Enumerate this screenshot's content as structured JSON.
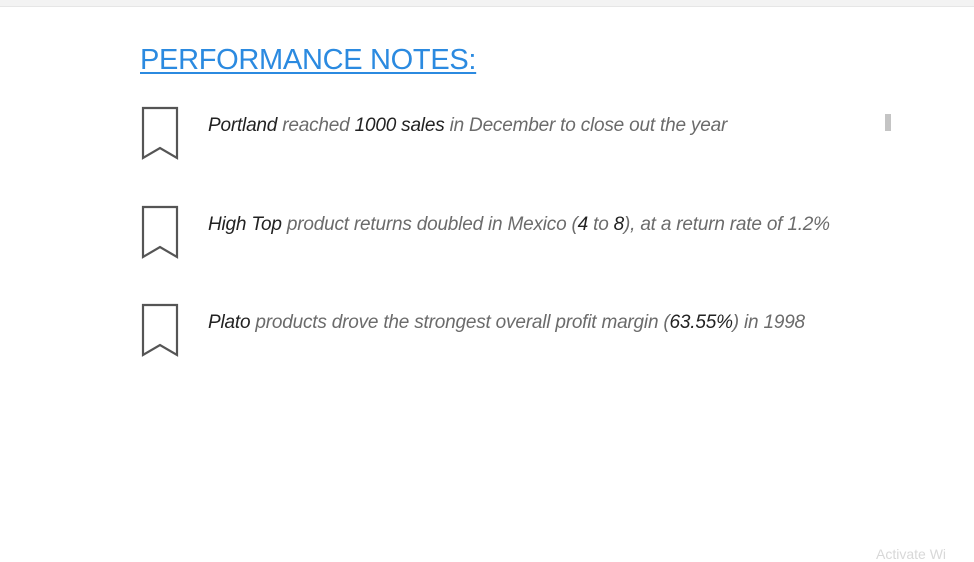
{
  "title": "PERFORMANCE NOTES:",
  "notes": [
    {
      "icon": "bookmark-icon",
      "parts": [
        {
          "text": "Portland",
          "emphasis": true
        },
        {
          "text": " reached ",
          "emphasis": false
        },
        {
          "text": "1000 sales",
          "emphasis": true
        },
        {
          "text": " in December to close out the year",
          "emphasis": false
        }
      ]
    },
    {
      "icon": "bookmark-icon",
      "parts": [
        {
          "text": "High Top",
          "emphasis": true
        },
        {
          "text": " product returns doubled in Mexico (",
          "emphasis": false
        },
        {
          "text": "4",
          "emphasis": true
        },
        {
          "text": " to ",
          "emphasis": false
        },
        {
          "text": "8",
          "emphasis": true
        },
        {
          "text": "), at a return rate of 1.2%",
          "emphasis": false
        }
      ]
    },
    {
      "icon": "bookmark-icon",
      "parts": [
        {
          "text": "Plato",
          "emphasis": true
        },
        {
          "text": " products drove the strongest overall profit margin (",
          "emphasis": false
        },
        {
          "text": "63.55%",
          "emphasis": true
        },
        {
          "text": ") in 1998",
          "emphasis": false
        }
      ]
    }
  ],
  "watermark": "Activate Wi",
  "colors": {
    "title": "#2b8ae0",
    "emphasis_text": "#222222",
    "body_text": "#6b6b6b",
    "icon_stroke": "#555555"
  }
}
